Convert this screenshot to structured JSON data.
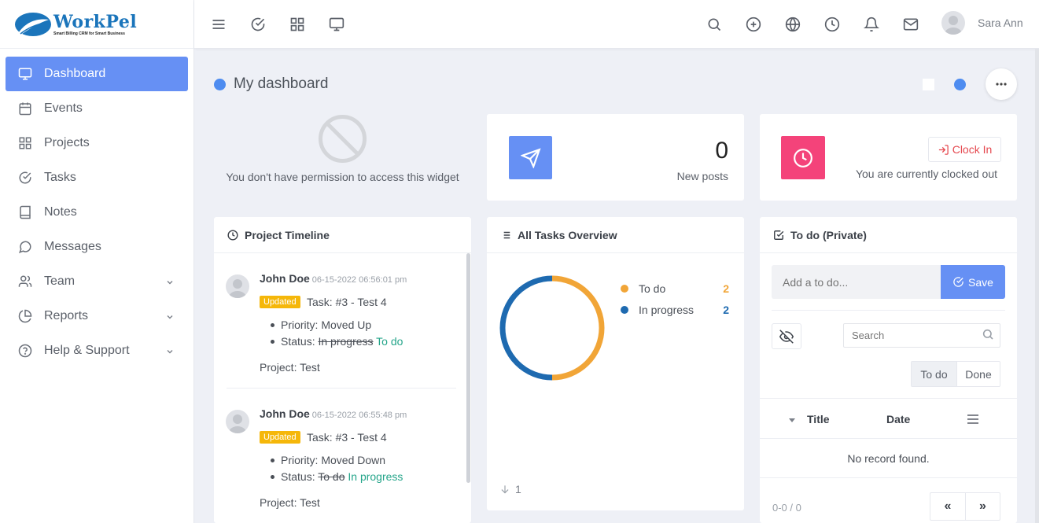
{
  "brand": {
    "name": "WorkPel",
    "tagline": "Smart Billing CRM for Smart Business"
  },
  "sidebar": {
    "items": [
      {
        "label": "Dashboard",
        "icon": "monitor-icon"
      },
      {
        "label": "Events",
        "icon": "calendar-icon"
      },
      {
        "label": "Projects",
        "icon": "grid-icon"
      },
      {
        "label": "Tasks",
        "icon": "check-circle-icon"
      },
      {
        "label": "Notes",
        "icon": "book-icon"
      },
      {
        "label": "Messages",
        "icon": "message-circle-icon"
      },
      {
        "label": "Team",
        "icon": "users-icon"
      },
      {
        "label": "Reports",
        "icon": "pie-chart-icon"
      },
      {
        "label": "Help & Support",
        "icon": "help-circle-icon"
      }
    ]
  },
  "topbar": {
    "user_name": "Sara Ann"
  },
  "dashboard": {
    "title": "My dashboard"
  },
  "no_permission": {
    "message": "You don't have permission to access this widget"
  },
  "posts": {
    "count": "0",
    "label": "New posts"
  },
  "clock": {
    "button_label": "Clock In",
    "status": "You are currently clocked out"
  },
  "timeline": {
    "title": "Project Timeline",
    "entries": [
      {
        "author": "John Doe",
        "date": "06-15-2022 06:56:01 pm",
        "badge": "Updated",
        "task": "Task: #3 - Test 4",
        "priority_label": "Priority:",
        "priority_value": "Moved Up",
        "status_label": "Status:",
        "status_old": "In progress",
        "status_new": "To do",
        "project": "Project: Test"
      },
      {
        "author": "John Doe",
        "date": "06-15-2022 06:55:48 pm",
        "badge": "Updated",
        "task": "Task: #3 - Test 4",
        "priority_label": "Priority:",
        "priority_value": "Moved Down",
        "status_label": "Status:",
        "status_old": "To do",
        "status_new": "In progress",
        "project": "Project: Test"
      }
    ]
  },
  "tasks_overview": {
    "title": "All Tasks Overview",
    "footer_count": "1"
  },
  "chart_data": {
    "type": "pie",
    "categories": [
      "To do",
      "In progress"
    ],
    "values": [
      2,
      2
    ],
    "colors": [
      "#f1a537",
      "#1e6ab0"
    ],
    "style": "donut"
  },
  "todo": {
    "title": "To do (Private)",
    "placeholder": "Add a to do...",
    "save_label": "Save",
    "search_placeholder": "Search",
    "tabs": [
      "To do",
      "Done"
    ],
    "columns": [
      "Title",
      "Date"
    ],
    "empty_message": "No record found.",
    "pager_info": "0-0 / 0",
    "prev_label": "«",
    "next_label": "»"
  }
}
